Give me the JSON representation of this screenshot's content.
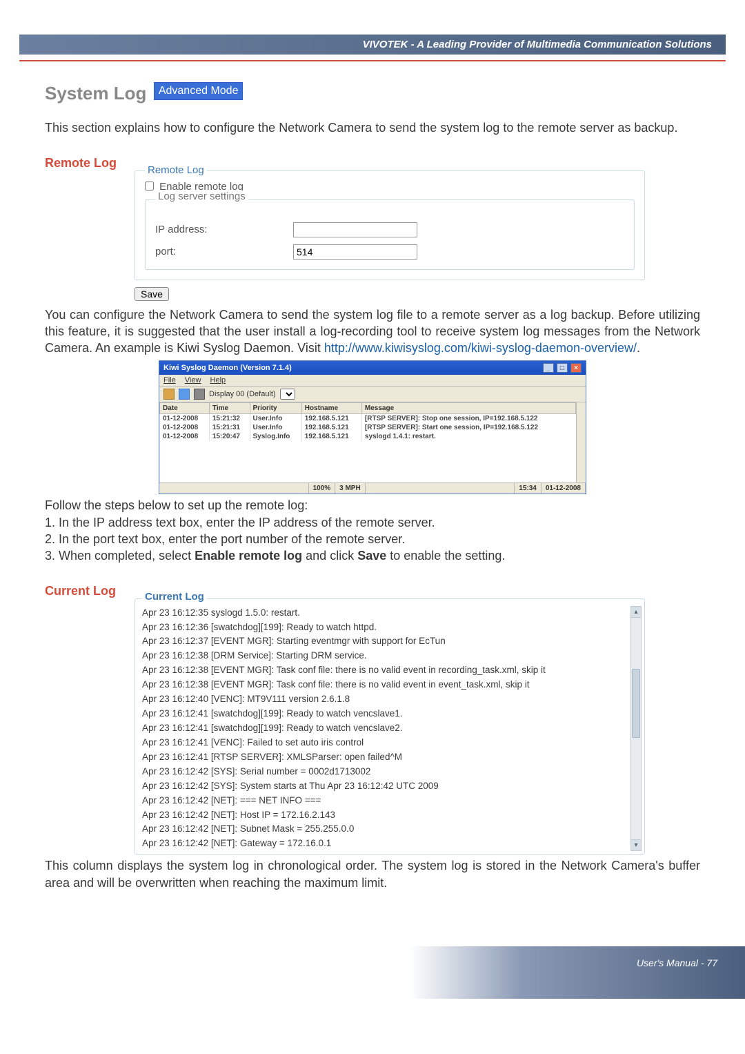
{
  "header": {
    "tagline": "VIVOTEK - A Leading Provider of Multimedia Communication Solutions"
  },
  "title": {
    "main": "System Log",
    "badge": "Advanced Mode"
  },
  "intro": "This section explains how to configure the Network Camera to send the system log to the remote server as backup.",
  "remote_log": {
    "heading": "Remote Log",
    "fieldset_title": "Remote Log",
    "enable_label": "Enable remote log",
    "sub_title": "Log server settings",
    "ip_label": "IP address:",
    "ip_value": "",
    "port_label": "port:",
    "port_value": "514",
    "save_label": "Save"
  },
  "paragraph_after_save": {
    "text_before_link": "You can configure the Network Camera to send the system log file to a remote server as a log backup. Before utilizing this feature, it is suggested that the user install a log-recording tool to receive system log messages from the Network Camera. An example is Kiwi Syslog Daemon. Visit ",
    "link_text": "http://www.kiwisyslog.com/kiwi-syslog-daemon-overview/",
    "text_after_link": "."
  },
  "kiwi": {
    "title": "Kiwi Syslog Daemon (Version 7.1.4)",
    "menu": [
      "File",
      "View",
      "Help"
    ],
    "display_label": "Display 00 (Default)",
    "columns": [
      "Date",
      "Time",
      "Priority",
      "Hostname",
      "Message"
    ],
    "rows": [
      {
        "date": "01-12-2008",
        "time": "15:21:32",
        "priority": "User.Info",
        "hostname": "192.168.5.121",
        "message": "[RTSP SERVER]: Stop one session, IP=192.168.5.122"
      },
      {
        "date": "01-12-2008",
        "time": "15:21:31",
        "priority": "User.Info",
        "hostname": "192.168.5.121",
        "message": "[RTSP SERVER]: Start one session, IP=192.168.5.122"
      },
      {
        "date": "01-12-2008",
        "time": "15:20:47",
        "priority": "Syslog.Info",
        "hostname": "192.168.5.121",
        "message": "syslogd 1.4.1: restart."
      }
    ],
    "status": {
      "pct": "100%",
      "mph": "3 MPH",
      "time": "15:34",
      "date": "01-12-2008"
    }
  },
  "steps": {
    "intro": "Follow the steps below to set up the remote log:",
    "s1": "1. In the IP address text box, enter the IP address of the remote server.",
    "s2": "2. In the port text box, enter the port number of the remote server.",
    "s3_a": "3. When completed, select ",
    "s3_b": "Enable remote log",
    "s3_c": " and click ",
    "s3_d": "Save",
    "s3_e": " to enable the setting."
  },
  "current_log": {
    "heading": "Current Log",
    "box_title": "Current Log",
    "lines": [
      "Apr 23 16:12:35 syslogd 1.5.0: restart.",
      "Apr 23 16:12:36 [swatchdog][199]: Ready to watch httpd.",
      "Apr 23 16:12:37 [EVENT MGR]: Starting eventmgr with support for EcTun",
      "Apr 23 16:12:38 [DRM Service]: Starting DRM service.",
      "Apr 23 16:12:38 [EVENT MGR]: Task conf file: there is no valid event in recording_task.xml, skip it",
      "Apr 23 16:12:38 [EVENT MGR]: Task conf file: there is no valid event in event_task.xml, skip it",
      "Apr 23 16:12:40 [VENC]: MT9V111 version 2.6.1.8",
      "Apr 23 16:12:41 [swatchdog][199]: Ready to watch vencslave1.",
      "Apr 23 16:12:41 [swatchdog][199]: Ready to watch vencslave2.",
      "Apr 23 16:12:41 [VENC]: Failed to set auto iris control",
      "Apr 23 16:12:41 [RTSP SERVER]: XMLSParser: open failed^M",
      "Apr 23 16:12:42 [SYS]: Serial number = 0002d1713002",
      "Apr 23 16:12:42 [SYS]: System starts at Thu Apr 23 16:12:42 UTC 2009",
      "Apr 23 16:12:42 [NET]: === NET INFO ===",
      "Apr 23 16:12:42 [NET]: Host IP = 172.16.2.143",
      "Apr 23 16:12:42 [NET]: Subnet Mask = 255.255.0.0",
      "Apr 23 16:12:42 [NET]: Gateway = 172.16.0.1"
    ]
  },
  "closing": "This column displays the system log in chronological order. The system log is stored in the Network Camera's buffer area and will be overwritten when reaching the maximum limit.",
  "footer": "User's Manual - 77"
}
